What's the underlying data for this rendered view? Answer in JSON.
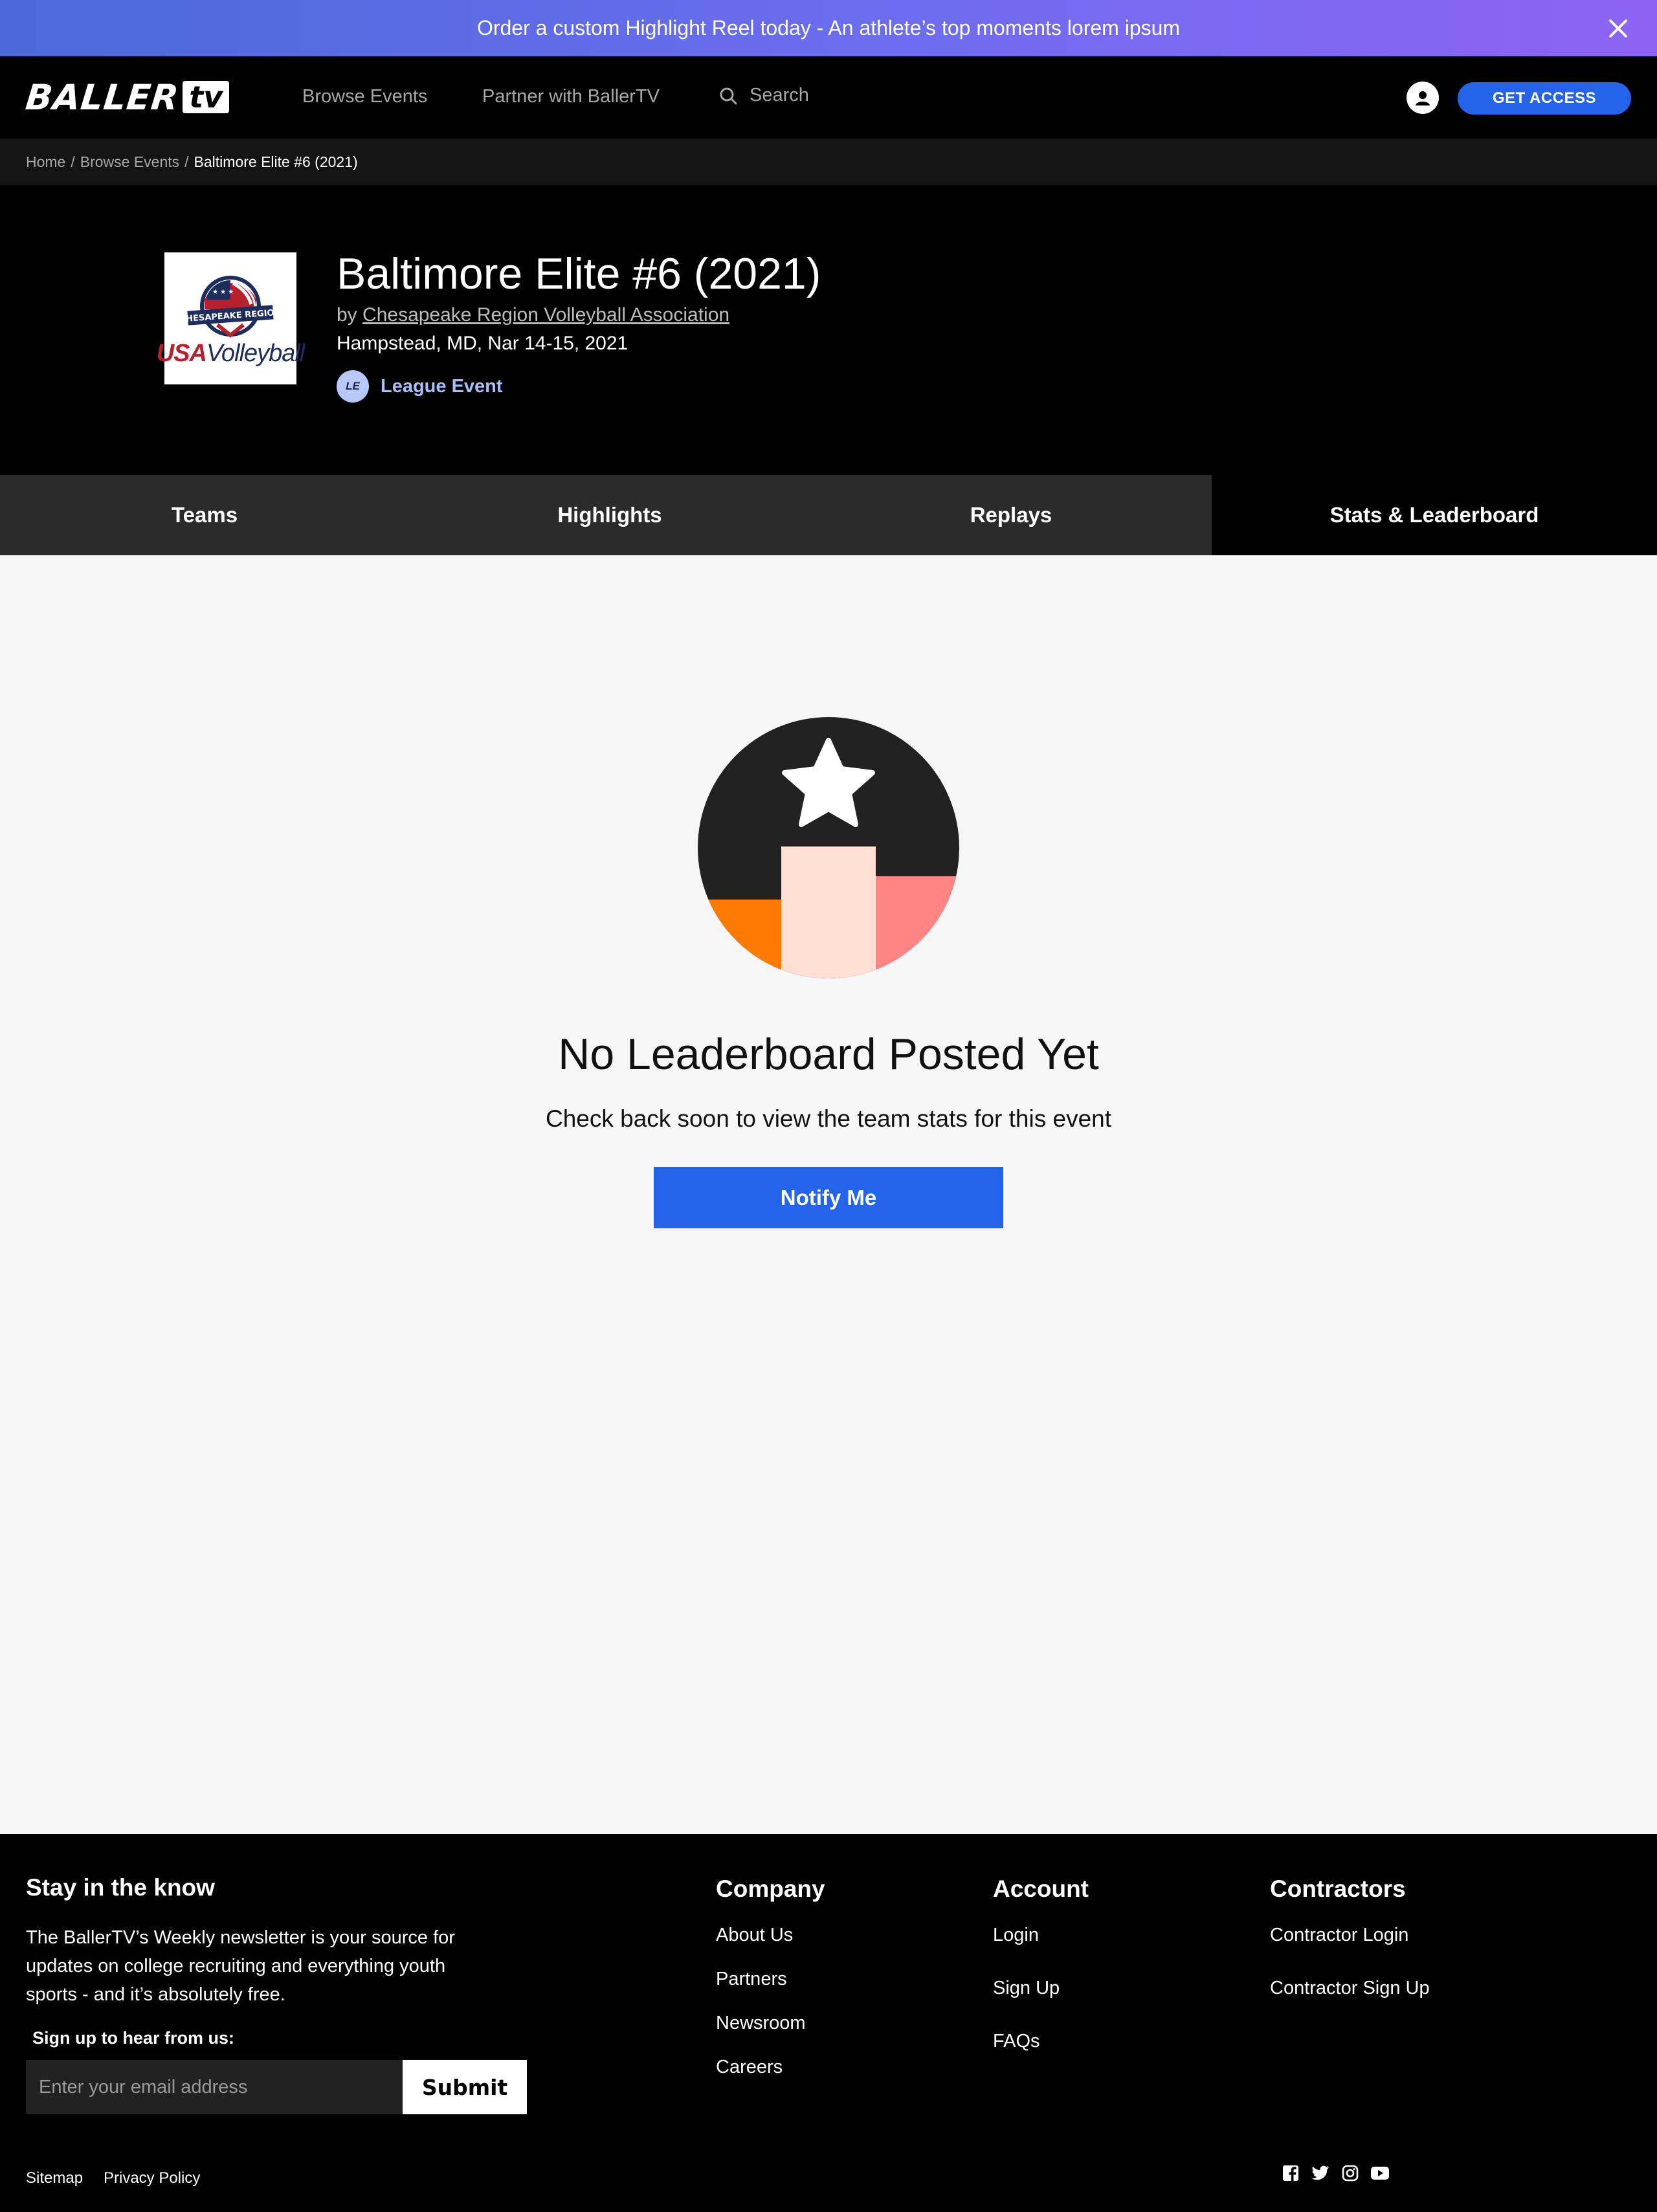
{
  "promo": {
    "text": "Order a custom Highlight Reel today - An athlete’s top moments lorem ipsum"
  },
  "nav": {
    "logo_main": "BALLER",
    "logo_suffix": "tv",
    "links": [
      "Browse Events",
      "Partner with BallerTV"
    ],
    "search_label": "Search",
    "cta_label": "GET ACCESS"
  },
  "breadcrumb": {
    "items": [
      "Home",
      "Browse Events"
    ],
    "current": "Baltimore Elite #6 (2021)"
  },
  "event": {
    "logo_region": "CHESAPEAKE REGION",
    "logo_usa": "USA",
    "logo_volleyball": "Volleyball",
    "title": "Baltimore Elite #6 (2021)",
    "by_prefix": "by",
    "organizer": "Chesapeake Region Volleyball Association",
    "location_date": "Hampstead, MD, Nar 14-15, 2021",
    "badge_initials": "LE",
    "badge_label": "League Event"
  },
  "tabs": [
    {
      "label": "Teams",
      "active": false
    },
    {
      "label": "Highlights",
      "active": false
    },
    {
      "label": "Replays",
      "active": false
    },
    {
      "label": "Stats & Leaderboard",
      "active": true
    }
  ],
  "empty_state": {
    "icon": "leaderboard-podium-star-icon",
    "title": "No Leaderboard Posted Yet",
    "subtitle": "Check back soon to view the team stats for this event",
    "button_label": "Notify Me"
  },
  "footer": {
    "newsletter": {
      "heading": "Stay in the know",
      "text": "The BallerTV’s Weekly newsletter is your source for updates on college recruiting and everything youth sports - and it’s absolutely free.",
      "signup_label": "Sign up to hear from us:",
      "email_placeholder": "Enter your email address",
      "submit_label": "Submit"
    },
    "columns": [
      {
        "heading": "Company",
        "links": [
          "About Us",
          "Partners",
          "Newsroom",
          "Careers"
        ]
      },
      {
        "heading": "Account",
        "links": [
          "Login",
          "Sign Up",
          "FAQs"
        ]
      },
      {
        "heading": "Contractors",
        "links": [
          "Contractor Login",
          "Contractor Sign Up"
        ]
      }
    ],
    "bottom_links": [
      "Sitemap",
      "Privacy Policy"
    ],
    "social_icons": [
      "facebook-icon",
      "twitter-icon",
      "instagram-icon",
      "youtube-icon"
    ]
  },
  "colors": {
    "accent": "#2563eb",
    "podium_left": "#ff7a00",
    "podium_center": "#ffdfd4",
    "podium_right": "#ff8585",
    "illustration_bg": "#222222"
  }
}
